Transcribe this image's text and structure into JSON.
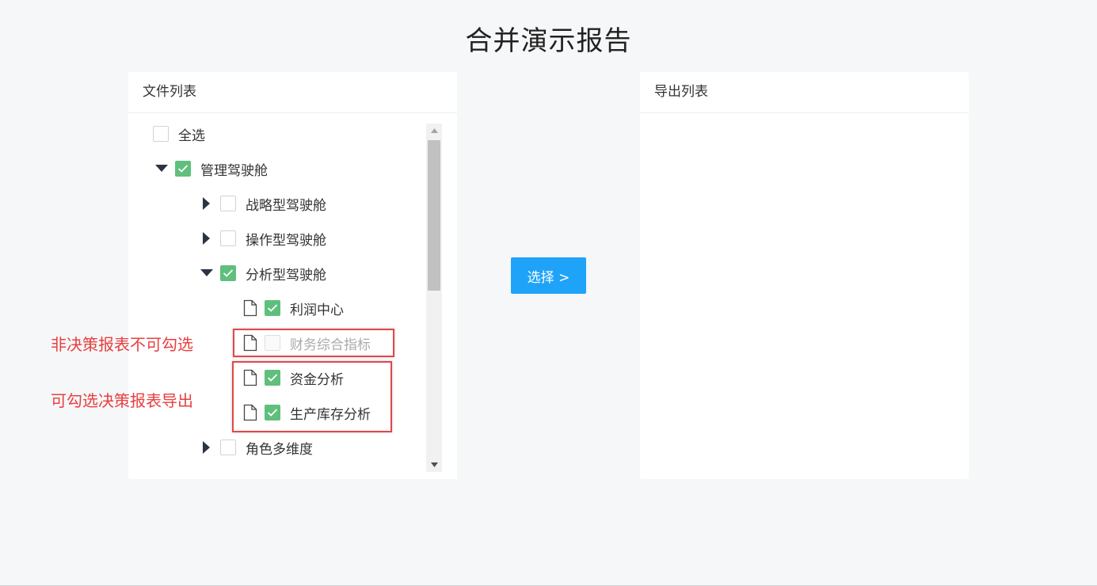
{
  "page": {
    "title": "合并演示报告"
  },
  "left_panel": {
    "title": "文件列表",
    "tree": {
      "select_all": {
        "label": "全选",
        "checked": false
      },
      "items": [
        {
          "label": "管理驾驶舱",
          "checked": true,
          "expanded": true
        },
        {
          "label": "战略型驾驶舱",
          "checked": false,
          "expanded": false
        },
        {
          "label": "操作型驾驶舱",
          "checked": false,
          "expanded": false
        },
        {
          "label": "分析型驾驶舱",
          "checked": true,
          "expanded": true
        },
        {
          "label": "利润中心",
          "checked": true,
          "type": "file"
        },
        {
          "label": "财务综合指标",
          "checked": false,
          "disabled": true,
          "type": "file"
        },
        {
          "label": "资金分析",
          "checked": true,
          "type": "file"
        },
        {
          "label": "生产库存分析",
          "checked": true,
          "type": "file"
        },
        {
          "label": "角色多维度",
          "checked": false,
          "expanded": false
        }
      ]
    }
  },
  "select_button": {
    "label": "选择 >"
  },
  "right_panel": {
    "title": "导出列表"
  },
  "annotations": {
    "not_selectable": "非决策报表不可勾选",
    "selectable": "可勾选决策报表导出"
  },
  "colors": {
    "accent": "#1fa3f8",
    "checked": "#5fbf7c",
    "annotation": "#e8403f"
  }
}
